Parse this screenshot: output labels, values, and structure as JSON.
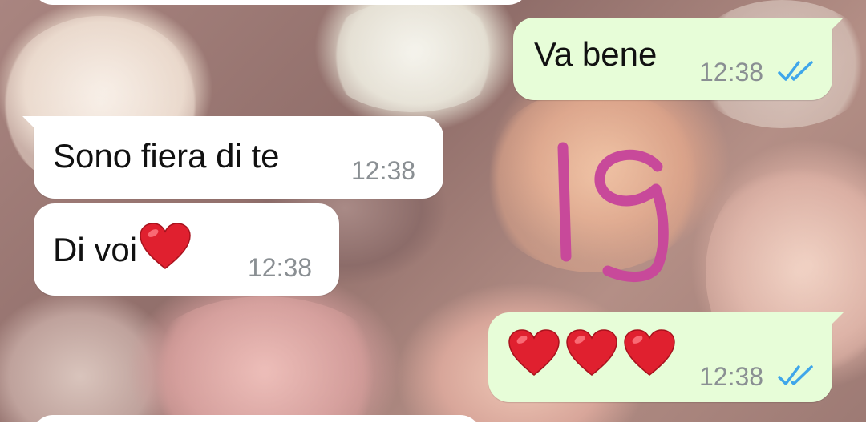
{
  "chat": {
    "messages": [
      {
        "direction": "outgoing",
        "text": "Va bene",
        "time": "12:38",
        "status": "read",
        "status_icon": "double-check-icon"
      },
      {
        "direction": "incoming",
        "text": "Sono fiera di te",
        "time": "12:38"
      },
      {
        "direction": "incoming",
        "text": "Di voi",
        "emoji": "heart-icon",
        "time": "12:38"
      },
      {
        "direction": "outgoing",
        "emojis": [
          "heart-icon",
          "heart-icon",
          "heart-icon"
        ],
        "time": "12:38",
        "status": "read",
        "status_icon": "double-check-icon"
      }
    ],
    "overlay_annotation": {
      "text": "19",
      "color": "#c8499a"
    }
  },
  "colors": {
    "incoming_bubble": "#ffffff",
    "outgoing_bubble": "#e7fdd8",
    "read_ticks": "#3fa6ea",
    "heart": "#e0202f",
    "timestamp": "#8a8f93"
  }
}
